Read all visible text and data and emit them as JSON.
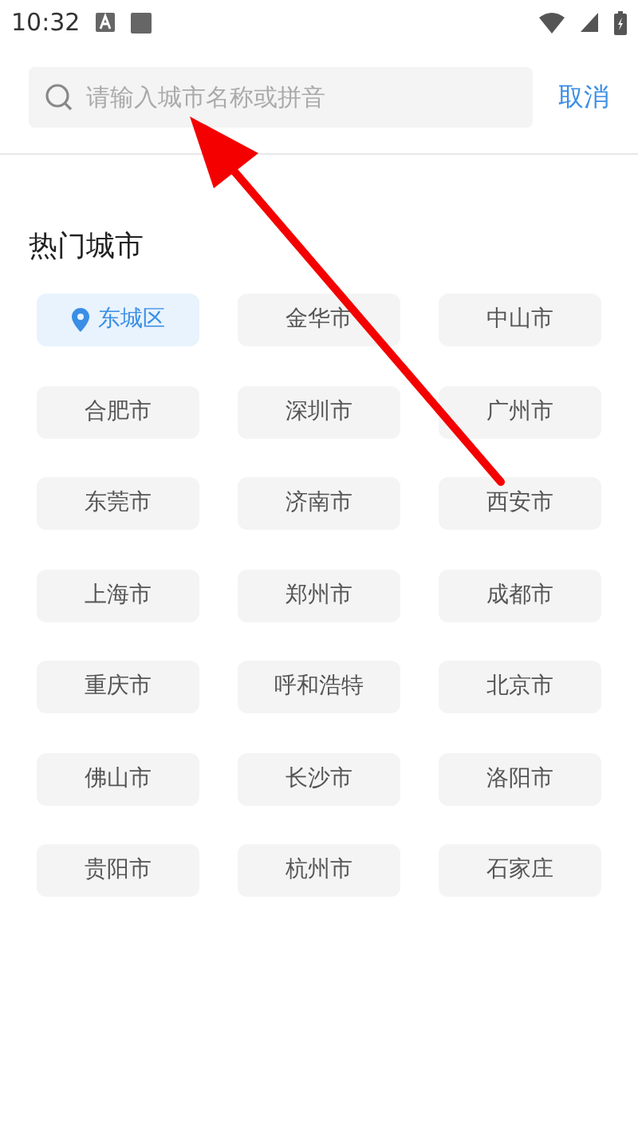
{
  "status_bar": {
    "time": "10:32"
  },
  "search": {
    "placeholder": "请输入城市名称或拼音",
    "cancel": "取消"
  },
  "hot_cities": {
    "title": "热门城市",
    "items": [
      {
        "label": "东城区",
        "kind": "location"
      },
      {
        "label": "金华市",
        "kind": "city"
      },
      {
        "label": "中山市",
        "kind": "city"
      },
      {
        "label": "合肥市",
        "kind": "city"
      },
      {
        "label": "深圳市",
        "kind": "city"
      },
      {
        "label": "广州市",
        "kind": "city"
      },
      {
        "label": "东莞市",
        "kind": "city"
      },
      {
        "label": "济南市",
        "kind": "city"
      },
      {
        "label": "西安市",
        "kind": "city"
      },
      {
        "label": "上海市",
        "kind": "city"
      },
      {
        "label": "郑州市",
        "kind": "city"
      },
      {
        "label": "成都市",
        "kind": "city"
      },
      {
        "label": "重庆市",
        "kind": "city"
      },
      {
        "label": "呼和浩特",
        "kind": "city"
      },
      {
        "label": "北京市",
        "kind": "city"
      },
      {
        "label": "佛山市",
        "kind": "city"
      },
      {
        "label": "长沙市",
        "kind": "city"
      },
      {
        "label": "洛阳市",
        "kind": "city"
      },
      {
        "label": "贵阳市",
        "kind": "city"
      },
      {
        "label": "杭州市",
        "kind": "city"
      },
      {
        "label": "石家庄",
        "kind": "city"
      }
    ]
  }
}
